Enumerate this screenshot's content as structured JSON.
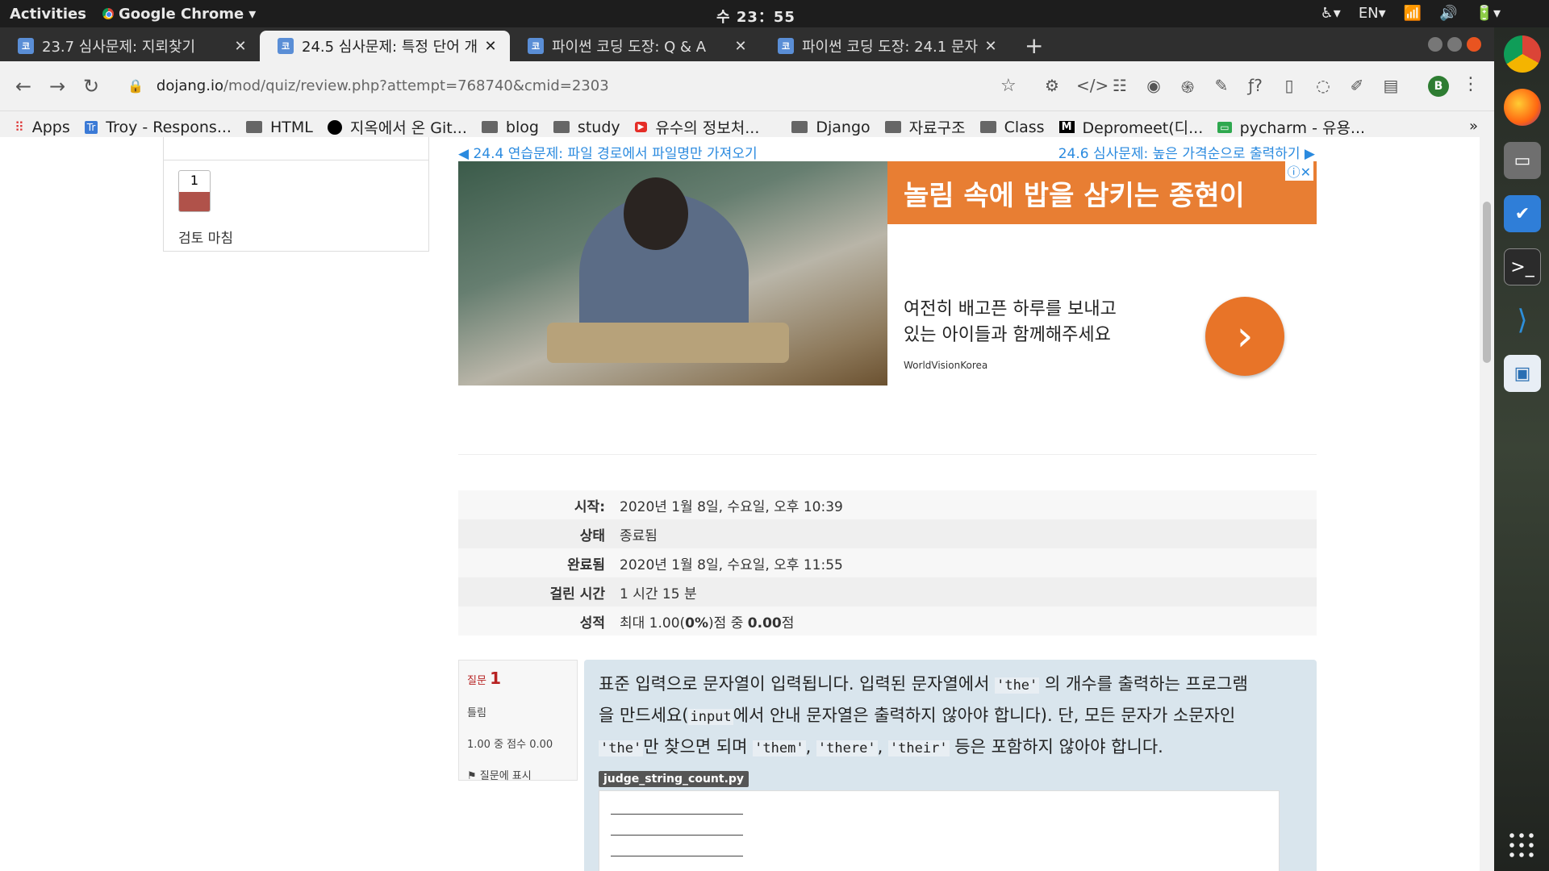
{
  "topbar": {
    "activities": "Activities",
    "app_name": "Google Chrome",
    "clock": "수 23：55",
    "lang": "EN"
  },
  "tabs": [
    {
      "title": "23.7 심사문제: 지뢰찾기",
      "active": false
    },
    {
      "title": "24.5 심사문제: 특정 단어 개",
      "active": true
    },
    {
      "title": "파이썬 코딩 도장: Q & A",
      "active": false
    },
    {
      "title": "파이썬 코딩 도장: 24.1 문자",
      "active": false
    }
  ],
  "address": {
    "host": "dojang.io",
    "path": "/mod/quiz/review.php?attempt=768740&cmid=2303"
  },
  "profile_initial": "B",
  "bookmarks": [
    {
      "label": "Apps",
      "icon": "apps-grid-icon"
    },
    {
      "label": "Troy - Respons...",
      "icon": "trello-icon"
    },
    {
      "label": "HTML",
      "icon": "folder-icon"
    },
    {
      "label": "지옥에서 온 Git...",
      "icon": "github-icon"
    },
    {
      "label": "blog",
      "icon": "folder-icon"
    },
    {
      "label": "study",
      "icon": "folder-icon"
    },
    {
      "label": "유수의 정보처...",
      "icon": "youtube-icon"
    },
    {
      "label": "Django",
      "icon": "folder-icon"
    },
    {
      "label": "자료구조",
      "icon": "folder-icon"
    },
    {
      "label": "Class",
      "icon": "folder-icon"
    },
    {
      "label": "Depromeet(디...",
      "icon": "medium-icon"
    },
    {
      "label": "pycharm - 유용...",
      "icon": "sheet-icon"
    }
  ],
  "sidebar": {
    "question_number": "1",
    "finish_review": "검토 마침"
  },
  "navlinks": {
    "prev": "◀ 24.4 연습문제: 파일 경로에서 파일명만 가져오기",
    "next": "24.6 심사문제: 높은 가격순으로 출력하기 ▶"
  },
  "ad": {
    "headline": "놀림 속에 밥을 삼키는 종현이",
    "body_line1": "여전히 배고픈 하루를 보내고",
    "body_line2": "있는 아이들과 함께해주세요",
    "source": "WorldVisionKorea",
    "cta": "›"
  },
  "summary": [
    {
      "label": "시작",
      "value": "2020년 1월 8일, 수요일, 오후 10:39"
    },
    {
      "label": "상태",
      "value": "종료됨"
    },
    {
      "label": "완료됨",
      "value": "2020년 1월 8일, 수요일, 오후 11:55"
    },
    {
      "label": "걸린 시간",
      "value": "1 시간 15 분"
    },
    {
      "label": "성적",
      "value_pre": "최대 1.00(",
      "value_b1": "0%",
      "value_mid": ")점 중 ",
      "value_b2": "0.00",
      "value_post": "점"
    }
  ],
  "question": {
    "label": "질문",
    "number": "1",
    "status": "틀림",
    "score": "1.00 중 점수 0.00",
    "flag": "질문에 표시",
    "text_1": "표준 입력으로 문자열이 입력됩니다. 입력된 문자열에서 ",
    "code_the": "'the'",
    "text_2": " 의 개수를 출력하는 프로그램",
    "text_3": "을 만드세요(",
    "code_input": "input",
    "text_4": "에서 안내 문자열은 출력하지 않아야 합니다). 단, 모든 문자가 소문자인",
    "text_5": "만 찾으면 되며 ",
    "code_them": "'them'",
    "code_there": "'there'",
    "code_their": "'their'",
    "text_6": " 등은 포함하지 않아야 합니다.",
    "comma": ", ",
    "filename": "judge_string_count.py"
  }
}
